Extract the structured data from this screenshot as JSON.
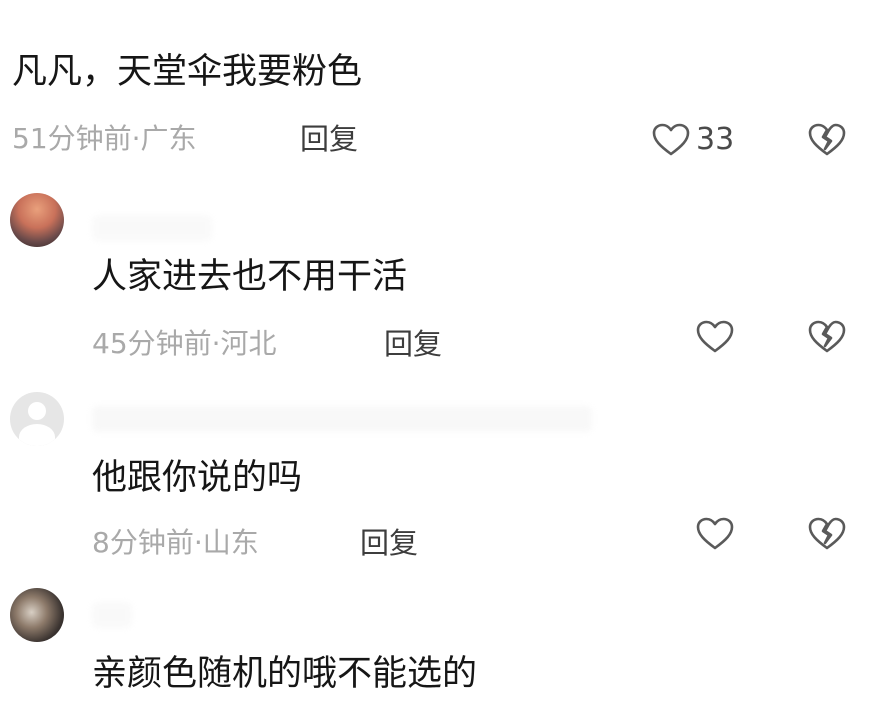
{
  "comments": [
    {
      "text": "凡凡，天堂伞我要粉色",
      "time": "51分钟前",
      "region": "广东",
      "reply_label": "回复",
      "like_count": "33"
    },
    {
      "text": "人家进去也不用干活",
      "time": "45分钟前",
      "region": "河北",
      "reply_label": "回复",
      "like_count": ""
    },
    {
      "text": "他跟你说的吗",
      "time": "8分钟前",
      "region": "山东",
      "reply_label": "回复",
      "like_count": ""
    },
    {
      "text": "亲颜色随机的哦不能选的"
    }
  ],
  "meta_separator": "·",
  "icons": {
    "like": "heart-outline-icon",
    "dislike": "broken-heart-icon"
  },
  "colors": {
    "text": "#161616",
    "meta": "#a9a9a9",
    "reply": "#3d3d3d",
    "icon": "#5a5a5a"
  }
}
